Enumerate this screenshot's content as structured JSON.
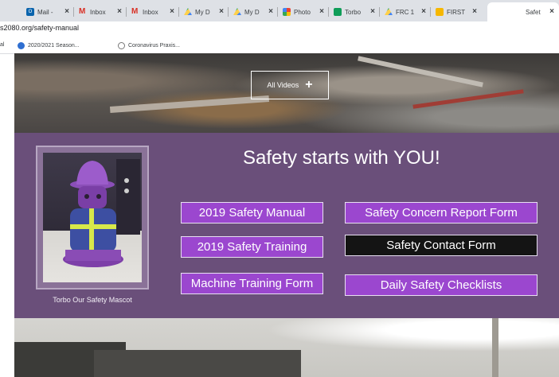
{
  "browser": {
    "tabs": [
      {
        "label": "Mail -",
        "icon": "outlook-icon",
        "color": "#0a64ad"
      },
      {
        "label": "Inbox",
        "icon": "gmail-icon",
        "color": "#d93025"
      },
      {
        "label": "Inbox",
        "icon": "gmail-icon",
        "color": "#d93025"
      },
      {
        "label": "My D",
        "icon": "drive-icon",
        "color": "#1fa463"
      },
      {
        "label": "My D",
        "icon": "drive-icon",
        "color": "#1fa463"
      },
      {
        "label": "Photo",
        "icon": "photos-icon",
        "color": "#fbbc04"
      },
      {
        "label": "Torbo",
        "icon": "sheets-icon",
        "color": "#0f9d58"
      },
      {
        "label": "FRC 1",
        "icon": "drive-icon",
        "color": "#1fa463"
      },
      {
        "label": "FIRST",
        "icon": "slides-icon",
        "color": "#f6b700"
      },
      {
        "label": "Safet",
        "icon": "none",
        "color": "#ffffff"
      }
    ],
    "url": "s2080.org/safety-manual",
    "bookmarks": [
      {
        "label": "al"
      },
      {
        "label": "2020/2021 Season..."
      },
      {
        "label": "Coronavirus Praxis..."
      }
    ]
  },
  "hero": {
    "all_videos_label": "All Videos",
    "plus_symbol": "+"
  },
  "safety": {
    "headline": "Safety starts with YOU!",
    "mascot_caption": "Torbo Our Safety Mascot",
    "buttons": {
      "manual": "2019 Safety Manual",
      "training": "2019 Safety Training",
      "machine": "Machine Training Form",
      "concern": "Safety Concern Report Form",
      "contact": "Safety Contact Form",
      "checklists": "Daily Safety Checklists"
    }
  },
  "colors": {
    "panel": "#6a4f7a",
    "button": "#9b47cf",
    "button_dark": "#141414"
  }
}
